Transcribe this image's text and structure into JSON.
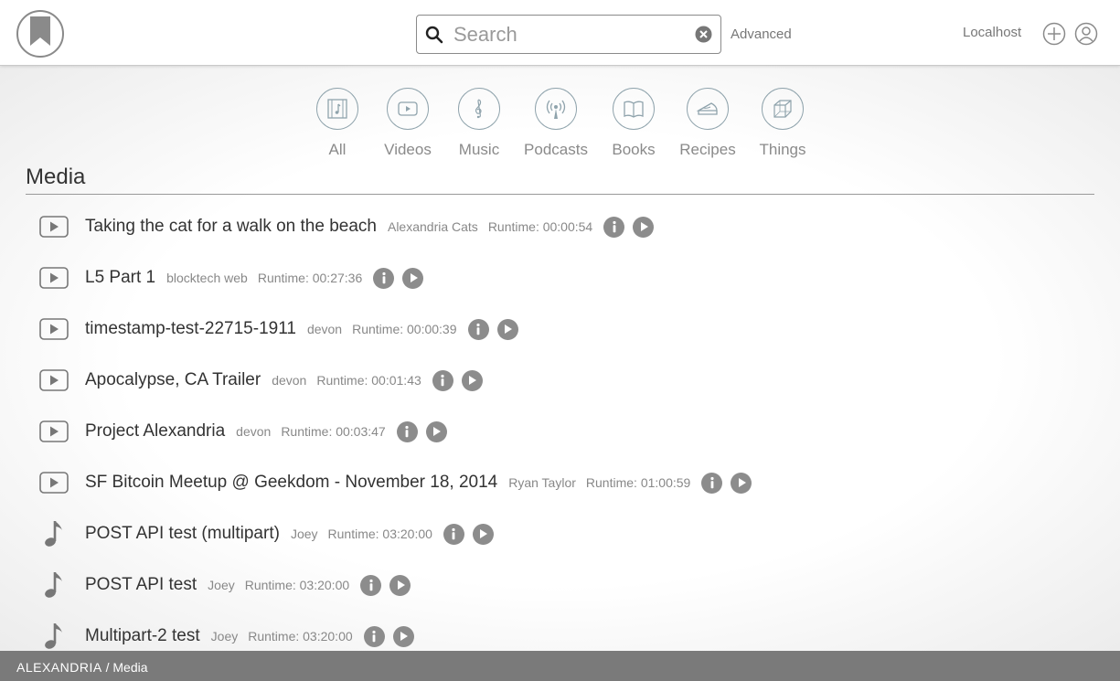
{
  "header": {
    "logo_icon": "bookmark-logo-icon",
    "search_placeholder": "Search",
    "search_value": "",
    "advanced_label": "Advanced",
    "host_label": "Localhost"
  },
  "categories": [
    {
      "label": "All",
      "icon": "film-music-icon"
    },
    {
      "label": "Videos",
      "icon": "youtube-play-icon"
    },
    {
      "label": "Music",
      "icon": "treble-clef-icon"
    },
    {
      "label": "Podcasts",
      "icon": "podcast-antenna-icon"
    },
    {
      "label": "Books",
      "icon": "open-book-icon"
    },
    {
      "label": "Recipes",
      "icon": "pie-slice-icon"
    },
    {
      "label": "Things",
      "icon": "cube-icon"
    }
  ],
  "section_title": "Media",
  "media": [
    {
      "type": "video",
      "title": "Taking the cat for a walk on the beach",
      "author": "Alexandria Cats",
      "runtime": "Runtime: 00:00:54"
    },
    {
      "type": "video",
      "title": "L5 Part 1",
      "author": "blocktech web",
      "runtime": "Runtime: 00:27:36"
    },
    {
      "type": "video",
      "title": "timestamp-test-22715-1911",
      "author": "devon",
      "runtime": "Runtime: 00:00:39"
    },
    {
      "type": "video",
      "title": "Apocalypse, CA Trailer",
      "author": "devon",
      "runtime": "Runtime: 00:01:43"
    },
    {
      "type": "video",
      "title": "Project Alexandria",
      "author": "devon",
      "runtime": "Runtime: 00:03:47"
    },
    {
      "type": "video",
      "title": "SF Bitcoin Meetup @ Geekdom - November 18, 2014",
      "author": "Ryan Taylor",
      "runtime": "Runtime: 01:00:59"
    },
    {
      "type": "music",
      "title": "POST API test (multipart)",
      "author": "Joey",
      "runtime": "Runtime: 03:20:00"
    },
    {
      "type": "music",
      "title": "POST API test",
      "author": "Joey",
      "runtime": "Runtime: 03:20:00"
    },
    {
      "type": "music",
      "title": "Multipart-2 test",
      "author": "Joey",
      "runtime": "Runtime: 03:20:00"
    }
  ],
  "footer": {
    "brand": "ALEXANDRIA",
    "separator": " / ",
    "page": "Media"
  }
}
